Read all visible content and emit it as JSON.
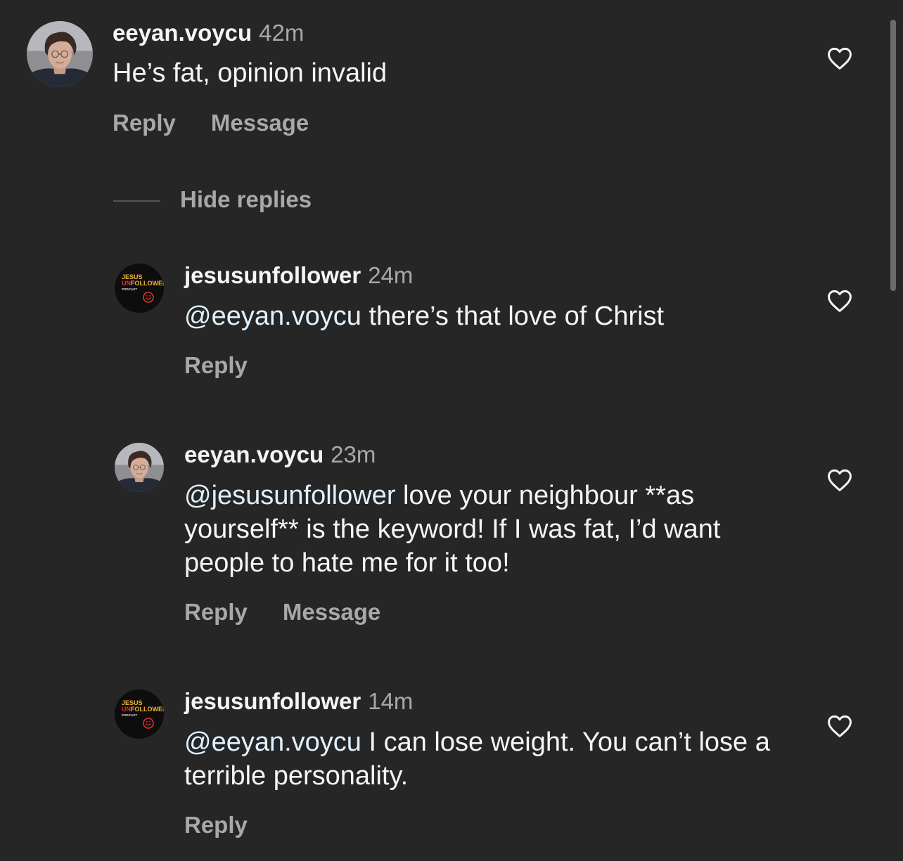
{
  "thread": {
    "main_comment": {
      "username": "eeyan.voycu",
      "time": "42m",
      "text": "He’s fat, opinion invalid",
      "reply_label": "Reply",
      "message_label": "Message",
      "avatar": "person-photo-avatar"
    },
    "hide_replies_label": "Hide replies",
    "replies": [
      {
        "username": "jesusunfollower",
        "time": "24m",
        "mention": "@eeyan.voycu",
        "text": " there’s that love of Christ",
        "reply_label": "Reply",
        "avatar": "podcast-logo-avatar"
      },
      {
        "username": "eeyan.voycu",
        "time": "23m",
        "mention": "@jesusunfollower",
        "text": " love your neighbour **as yourself** is the keyword! If I was fat, I’d want people to hate me for it too!",
        "reply_label": "Reply",
        "message_label": "Message",
        "avatar": "person-photo-avatar"
      },
      {
        "username": "jesusunfollower",
        "time": "14m",
        "mention": "@eeyan.voycu",
        "text": " I can lose weight. You can’t lose a terrible personality.",
        "reply_label": "Reply",
        "avatar": "podcast-logo-avatar"
      }
    ]
  },
  "logo_text": {
    "line1": "JESUS",
    "line2_prefix": "UN",
    "line2_rest": "FOLLOWER",
    "line3": "PODCAST"
  },
  "icons": {
    "like": "heart-outline-icon"
  },
  "colors": {
    "background": "#262626",
    "primary_text": "#f5f5f5",
    "secondary_text": "#a8a8a8",
    "mention": "#e0f1ff",
    "logo_yellow": "#f2b632",
    "logo_red": "#e0342c"
  }
}
